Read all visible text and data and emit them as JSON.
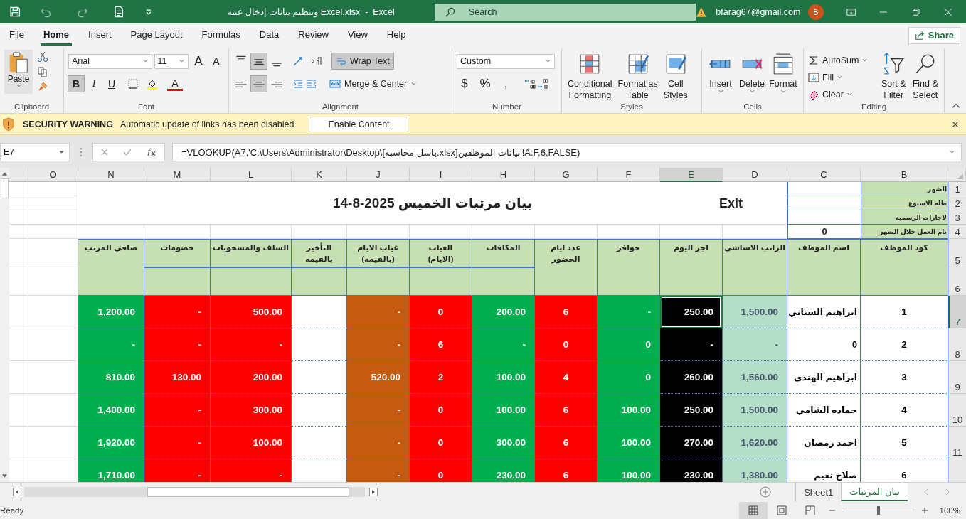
{
  "title_bar": {
    "title": "وتنظيم بيانات إدخال عينة Excel.xlsx  -  Excel",
    "search_placeholder": "Search",
    "account": "bfarag67@gmail.com",
    "avatar_initial": "B"
  },
  "ribbon_tabs": [
    {
      "label": "File",
      "selected": false
    },
    {
      "label": "Home",
      "selected": true
    },
    {
      "label": "Insert",
      "selected": false
    },
    {
      "label": "Page Layout",
      "selected": false
    },
    {
      "label": "Formulas",
      "selected": false
    },
    {
      "label": "Data",
      "selected": false
    },
    {
      "label": "Review",
      "selected": false
    },
    {
      "label": "View",
      "selected": false
    },
    {
      "label": "Help",
      "selected": false
    }
  ],
  "share": "Share",
  "ribbon": {
    "clipboard": {
      "paste": "Paste",
      "label": "Clipboard"
    },
    "font": {
      "name": "Arial",
      "size": "11",
      "grow": "A",
      "shrink": "A",
      "styles": [
        {
          "label": "B",
          "selected": true
        },
        {
          "label": "I",
          "selected": false
        },
        {
          "label": "U",
          "selected": false
        }
      ],
      "font_color": "A",
      "label": "Font"
    },
    "alignment": {
      "vertical": [
        {
          "selected": false
        },
        {
          "selected": true
        },
        {
          "selected": false
        }
      ],
      "horizontal": [
        {
          "selected": false
        },
        {
          "selected": true
        },
        {
          "selected": false
        }
      ],
      "wrap_text": {
        "label": "Wrap Text",
        "selected": true
      },
      "merge": "Merge & Center",
      "label": "Alignment"
    },
    "number": {
      "format": "Custom",
      "symbols": [
        "$",
        "%",
        ","
      ],
      "label": "Number"
    },
    "styles": {
      "buttons": [
        {
          "lines": [
            "Conditional",
            "Formatting"
          ]
        },
        {
          "lines": [
            "Format as",
            "Table"
          ]
        },
        {
          "lines": [
            "Cell",
            "Styles"
          ]
        }
      ],
      "label": "Styles"
    },
    "cells": {
      "buttons": [
        "Insert",
        "Delete",
        "Format"
      ],
      "label": "Cells"
    },
    "editing": {
      "small": [
        "AutoSum",
        "Fill",
        "Clear"
      ],
      "big": [
        {
          "lines": [
            "Sort &",
            "Filter"
          ]
        },
        {
          "lines": [
            "Find &",
            "Select"
          ]
        }
      ],
      "label": "Editing"
    }
  },
  "security_bar": {
    "title": "SECURITY WARNING",
    "message": "Automatic update of links has been disabled",
    "button": "Enable Content"
  },
  "formula_bar": {
    "name_box": "E7",
    "formula": "=VLOOKUP(A7,'C:\\Users\\Administrator\\Desktop\\[باسل محاسبه.xlsx]بيانات الموظفين'!A:F,6,FALSE)"
  },
  "sheet": {
    "column_letters": [
      {
        "label": "O",
        "selected": false
      },
      {
        "label": "N",
        "selected": false
      },
      {
        "label": "M",
        "selected": false
      },
      {
        "label": "L",
        "selected": false
      },
      {
        "label": "K",
        "selected": false
      },
      {
        "label": "J",
        "selected": false
      },
      {
        "label": "I",
        "selected": false
      },
      {
        "label": "H",
        "selected": false
      },
      {
        "label": "G",
        "selected": false
      },
      {
        "label": "F",
        "selected": false
      },
      {
        "label": "E",
        "selected": true
      },
      {
        "label": "D",
        "selected": false
      },
      {
        "label": "C",
        "selected": false
      },
      {
        "label": "B",
        "selected": false
      }
    ],
    "row_numbers": [
      {
        "label": "1",
        "selected": false
      },
      {
        "label": "2",
        "selected": false
      },
      {
        "label": "3",
        "selected": false
      },
      {
        "label": "4",
        "selected": false
      },
      {
        "label": "5",
        "selected": false
      },
      {
        "label": "6",
        "selected": false
      },
      {
        "label": "7",
        "selected": true
      },
      {
        "label": "8",
        "selected": false
      },
      {
        "label": "9",
        "selected": false
      },
      {
        "label": "10",
        "selected": false
      },
      {
        "label": "11",
        "selected": false
      }
    ],
    "info_rows": [
      {
        "label": "الشهر"
      },
      {
        "label": "طله الاسبوع"
      },
      {
        "label": "لاجازات الرسميه"
      },
      {
        "label": "يام العمل خلال الشهر",
        "value": "0"
      }
    ],
    "title": "بيان مرتبات الخميس 2025-8-14",
    "exit_button": "Exit",
    "columns": [
      {
        "header": "صافي المرتب",
        "color": "#00b050"
      },
      {
        "header": "خصومات",
        "color": "#ff0000"
      },
      {
        "header": "السلف والمسحوبات",
        "color": "#ff0000"
      },
      {
        "header": "التأخير بالقيمه",
        "color": "#ffffff"
      },
      {
        "header": "غياب الايام\n(بالقيمه)",
        "color": "#c55a11"
      },
      {
        "header": "الغياب\n(الايام)",
        "color": "#ff0000"
      },
      {
        "header": "المكافات",
        "color": "#00b050"
      },
      {
        "header": "عدد ايام\nالحضور",
        "color": "#ff0000"
      },
      {
        "header": "حوافز",
        "color": "#00b050"
      },
      {
        "header": "اجر اليوم",
        "color": "#000000"
      },
      {
        "header": "الراتب الاساسي",
        "color": "#b4dec8"
      },
      {
        "header": "اسم الموظف",
        "color": "#ffffff"
      },
      {
        "header": "كود الموظف",
        "color": "#ffffff"
      }
    ],
    "rows": [
      {
        "cells": [
          "1,200.00",
          "-",
          "500.00",
          "",
          "-",
          "0",
          "200.00",
          "6",
          "-",
          "250.00",
          "1,500.00",
          "ابراهيم السناني",
          "1"
        ]
      },
      {
        "cells": [
          "-",
          "-",
          "-",
          "",
          "-",
          "6",
          "-",
          "0",
          "0",
          "-",
          "-",
          "0",
          "2"
        ]
      },
      {
        "cells": [
          "810.00",
          "130.00",
          "200.00",
          "",
          "520.00",
          "2",
          "100.00",
          "4",
          "0",
          "260.00",
          "1,560.00",
          "ابراهيم الهندي",
          "3"
        ]
      },
      {
        "cells": [
          "1,400.00",
          "-",
          "300.00",
          "",
          "-",
          "0",
          "100.00",
          "6",
          "100.00",
          "250.00",
          "1,500.00",
          "حماده الشامي",
          "4"
        ]
      },
      {
        "cells": [
          "1,920.00",
          "-",
          "100.00",
          "",
          "-",
          "0",
          "300.00",
          "6",
          "100.00",
          "270.00",
          "1,620.00",
          "احمد رمضان",
          "5"
        ]
      },
      {
        "cells": [
          "1,710.00",
          "-",
          "-",
          "",
          "-",
          "0",
          "230.00",
          "6",
          "100.00",
          "230.00",
          "1,380.00",
          "صلاح نعيم",
          "6"
        ]
      }
    ]
  },
  "sheet_tabs": [
    {
      "label": "Sheet1",
      "selected": false
    },
    {
      "label": "بيان المرتبات",
      "selected": true
    }
  ],
  "status_bar": {
    "status": "Ready",
    "zoom_slider": {
      "level": 0.5
    },
    "zoom": "100%"
  }
}
